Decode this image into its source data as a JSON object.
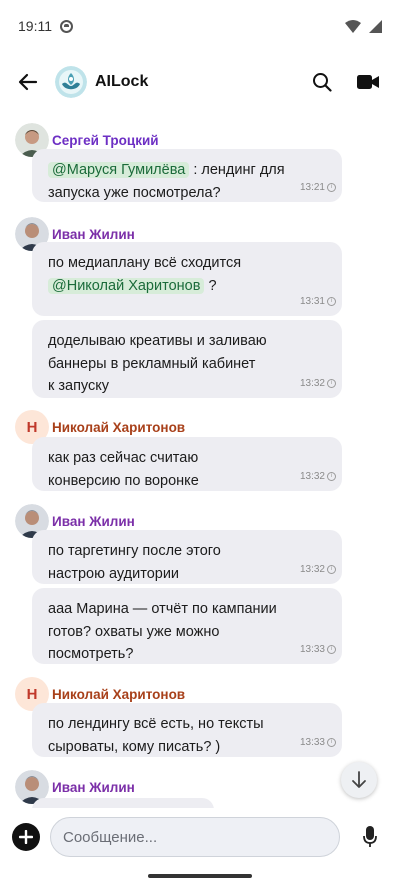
{
  "status_bar": {
    "time": "19:11"
  },
  "header": {
    "title": "AILock"
  },
  "messages": [
    {
      "sender": "Сергей Троцкий",
      "bubbles": [
        {
          "lines": [
            [
              {
                "mention": "@Маруся Гумилёва"
              },
              {
                "text": " : лендинг для"
              }
            ],
            [
              {
                "text": "запуска уже посмотрела?"
              }
            ]
          ],
          "time": "13:21"
        }
      ]
    },
    {
      "sender": "Иван Жилин",
      "bubbles": [
        {
          "lines": [
            [
              {
                "text": "по медиаплану всё сходится"
              }
            ],
            [
              {
                "mention": "@Николай Харитонов"
              },
              {
                "text": " ?"
              }
            ]
          ],
          "time": "13:31"
        },
        {
          "lines": [
            [
              {
                "text": "доделываю креативы и заливаю"
              }
            ],
            [
              {
                "text": "баннеры в рекламный кабинет"
              }
            ],
            [
              {
                "text": "к запуску"
              }
            ]
          ],
          "time": "13:32"
        }
      ]
    },
    {
      "sender": "Николай Харитонов",
      "avatar_letter": "Н",
      "bubbles": [
        {
          "lines": [
            [
              {
                "text": "как раз сейчас считаю"
              }
            ],
            [
              {
                "text": "конверсию по воронке"
              }
            ]
          ],
          "time": "13:32"
        }
      ]
    },
    {
      "sender": "Иван Жилин",
      "bubbles": [
        {
          "lines": [
            [
              {
                "text": "по таргетингу после этого"
              }
            ],
            [
              {
                "text": "настрою аудитории"
              }
            ]
          ],
          "time": "13:32"
        },
        {
          "lines": [
            [
              {
                "text": "ааа Марина — отчёт по кампании"
              }
            ],
            [
              {
                "text": "готов? охваты уже можно"
              }
            ],
            [
              {
                "text": "посмотреть?"
              }
            ]
          ],
          "time": "13:33"
        }
      ]
    },
    {
      "sender": "Николай Харитонов",
      "avatar_letter": "Н",
      "bubbles": [
        {
          "lines": [
            [
              {
                "text": "по лендингу всё есть, но тексты"
              }
            ],
            [
              {
                "text": "сыроваты, кому писать? )"
              }
            ]
          ],
          "time": "13:33"
        }
      ]
    },
    {
      "sender": "Иван Жилин",
      "bubbles": []
    }
  ],
  "composer": {
    "placeholder": "Сообщение..."
  },
  "colors": {
    "mention_bg": "#d7ecd9",
    "mention_text": "#1b6b3a",
    "bubble_bg": "#ededf2"
  }
}
